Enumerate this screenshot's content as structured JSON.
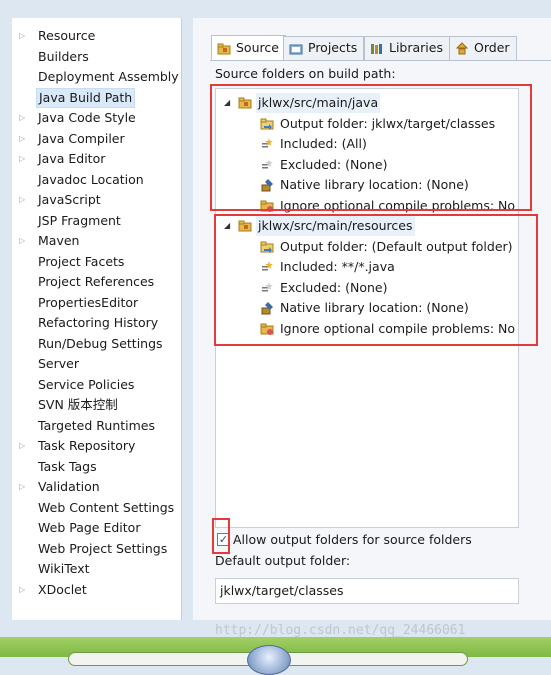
{
  "left_panel": {
    "items": [
      {
        "label": "Resource",
        "expandable": true
      },
      {
        "label": "Builders",
        "expandable": false
      },
      {
        "label": "Deployment Assembly",
        "expandable": false
      },
      {
        "label": "Java Build Path",
        "expandable": false,
        "selected": true
      },
      {
        "label": "Java Code Style",
        "expandable": true
      },
      {
        "label": "Java Compiler",
        "expandable": true
      },
      {
        "label": "Java Editor",
        "expandable": true
      },
      {
        "label": "Javadoc Location",
        "expandable": false
      },
      {
        "label": "JavaScript",
        "expandable": true
      },
      {
        "label": "JSP Fragment",
        "expandable": false
      },
      {
        "label": "Maven",
        "expandable": true
      },
      {
        "label": "Project Facets",
        "expandable": false
      },
      {
        "label": "Project References",
        "expandable": false
      },
      {
        "label": "PropertiesEditor",
        "expandable": false
      },
      {
        "label": "Refactoring History",
        "expandable": false
      },
      {
        "label": "Run/Debug Settings",
        "expandable": false
      },
      {
        "label": "Server",
        "expandable": false
      },
      {
        "label": "Service Policies",
        "expandable": false
      },
      {
        "label": "SVN 版本控制",
        "expandable": false
      },
      {
        "label": "Targeted Runtimes",
        "expandable": false
      },
      {
        "label": "Task Repository",
        "expandable": true
      },
      {
        "label": "Task Tags",
        "expandable": false
      },
      {
        "label": "Validation",
        "expandable": true
      },
      {
        "label": "Web Content Settings",
        "expandable": false
      },
      {
        "label": "Web Page Editor",
        "expandable": false
      },
      {
        "label": "Web Project Settings",
        "expandable": false
      },
      {
        "label": "WikiText",
        "expandable": false
      },
      {
        "label": "XDoclet",
        "expandable": true
      }
    ]
  },
  "tabs": [
    {
      "label": "Source",
      "icon": "source-folder-icon",
      "active": true
    },
    {
      "label": "Projects",
      "icon": "projects-icon",
      "active": false
    },
    {
      "label": "Libraries",
      "icon": "libraries-icon",
      "active": false
    },
    {
      "label": "Order",
      "icon": "order-icon",
      "active": false
    }
  ],
  "source_tab": {
    "section_label": "Source folders on build path:",
    "folders": [
      {
        "name": "jklwx/src/main/java",
        "children": [
          {
            "icon": "output-folder-icon",
            "label": "Output folder: jklwx/target/classes"
          },
          {
            "icon": "included-icon",
            "label": "Included: (All)"
          },
          {
            "icon": "excluded-icon",
            "label": "Excluded: (None)"
          },
          {
            "icon": "native-library-icon",
            "label": "Native library location: (None)"
          },
          {
            "icon": "compile-problems-icon",
            "label": "Ignore optional compile problems: No"
          }
        ]
      },
      {
        "name": "jklwx/src/main/resources",
        "children": [
          {
            "icon": "output-folder-icon",
            "label": "Output folder: (Default output folder)"
          },
          {
            "icon": "included-icon",
            "label": "Included: **/*.java"
          },
          {
            "icon": "excluded-icon",
            "label": "Excluded: (None)"
          },
          {
            "icon": "native-library-icon",
            "label": "Native library location: (None)"
          },
          {
            "icon": "compile-problems-icon",
            "label": "Ignore optional compile problems: No"
          }
        ]
      }
    ],
    "allow_output_folders_label": "Allow output folders for source folders",
    "allow_output_folders_checked": true,
    "checkbox_mark": "✓",
    "default_output_label": "Default output folder:",
    "default_output_value": "jklwx/target/classes"
  },
  "watermark": "http://blog.csdn.net/qq_24466061",
  "colors": {
    "highlight_box": "#e33b3b",
    "selection": "#d9e9f9",
    "panel_bg": "#f4f6f9",
    "taskbar": "#8cc152"
  }
}
